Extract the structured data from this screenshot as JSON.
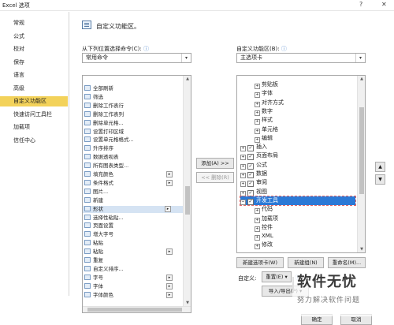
{
  "window": {
    "title": "Excel 选项",
    "help": "?",
    "close": "✕"
  },
  "nav": {
    "items": [
      {
        "label": "常规"
      },
      {
        "label": "公式"
      },
      {
        "label": "校对"
      },
      {
        "label": "保存"
      },
      {
        "label": "语言"
      },
      {
        "label": "高级"
      },
      {
        "label": "自定义功能区",
        "selected": true
      },
      {
        "label": "快速访问工具栏"
      },
      {
        "label": "加载项"
      },
      {
        "label": "信任中心"
      }
    ],
    "selected_color": "#f3d25a"
  },
  "header": {
    "title": "自定义功能区。"
  },
  "left": {
    "label": "从下列位置选择命令(C):",
    "info_icon": "ⓘ",
    "dropdown_value": "常用命令",
    "commands": [
      {
        "label": "全部刷新"
      },
      {
        "label": "筛选"
      },
      {
        "label": "删除工作表行"
      },
      {
        "label": "删除工作表列"
      },
      {
        "label": "删除单元格..."
      },
      {
        "label": "设置打印区域"
      },
      {
        "label": "设置单元格格式..."
      },
      {
        "label": "升序排序"
      },
      {
        "label": "数据透视表"
      },
      {
        "label": "所有图表类型..."
      },
      {
        "label": "填充颜色",
        "sub": true
      },
      {
        "label": "条件格式",
        "sub": true
      },
      {
        "label": "图片..."
      },
      {
        "label": "新建"
      },
      {
        "label": "形状",
        "sub": true,
        "highlight": true
      },
      {
        "label": "选择性粘贴..."
      },
      {
        "label": "页面设置"
      },
      {
        "label": "增大字号"
      },
      {
        "label": "粘贴"
      },
      {
        "label": "粘贴",
        "sub": true
      },
      {
        "label": "重复"
      },
      {
        "label": "自定义排序..."
      },
      {
        "label": "字号",
        "sub": true
      },
      {
        "label": "字体",
        "sub": true
      },
      {
        "label": "字体颜色",
        "sub": true
      }
    ]
  },
  "middle": {
    "add_label": "添加(A) >>",
    "remove_label": "<< 删除(R)"
  },
  "right": {
    "label": "自定义功能区(B):",
    "info_icon": "ⓘ",
    "dropdown_value": "主选项卡",
    "tree": [
      {
        "label": "剪贴板",
        "exp": "+",
        "cb": false,
        "level": 2
      },
      {
        "label": "字体",
        "exp": "+",
        "cb": false,
        "level": 2
      },
      {
        "label": "对齐方式",
        "exp": "+",
        "cb": false,
        "level": 2
      },
      {
        "label": "数字",
        "exp": "+",
        "cb": false,
        "level": 2
      },
      {
        "label": "样式",
        "exp": "+",
        "cb": false,
        "level": 2
      },
      {
        "label": "单元格",
        "exp": "+",
        "cb": false,
        "level": 2
      },
      {
        "label": "编辑",
        "exp": "+",
        "cb": false,
        "level": 2
      },
      {
        "label": "插入",
        "exp": "+",
        "cb": true,
        "level": 1
      },
      {
        "label": "页面布局",
        "exp": "+",
        "cb": true,
        "level": 1
      },
      {
        "label": "公式",
        "exp": "+",
        "cb": true,
        "level": 1
      },
      {
        "label": "数据",
        "exp": "+",
        "cb": true,
        "level": 1
      },
      {
        "label": "审阅",
        "exp": "+",
        "cb": true,
        "level": 1
      },
      {
        "label": "视图",
        "exp": "+",
        "cb": true,
        "level": 1
      },
      {
        "label": "开发工具",
        "exp": "−",
        "cb": true,
        "level": 1,
        "selected": true
      },
      {
        "label": "代码",
        "exp": "+",
        "cb": false,
        "level": 2
      },
      {
        "label": "加载项",
        "exp": "+",
        "cb": false,
        "level": 2
      },
      {
        "label": "控件",
        "exp": "+",
        "cb": false,
        "level": 2
      },
      {
        "label": "XML",
        "exp": "+",
        "cb": false,
        "level": 2
      },
      {
        "label": "修改",
        "exp": "+",
        "cb": false,
        "level": 2
      }
    ],
    "selected_color": "#2b79d6"
  },
  "buttons": {
    "new_tab": "新建选项卡(W)",
    "new_group": "新建组(N)",
    "rename": "重命名(M)...",
    "customize_label": "自定义:",
    "reset": "重置(E) ▾",
    "import_export": "导入/导出(P) ▾",
    "ok": "确定",
    "cancel": "取消"
  },
  "watermark": {
    "title": "软件无忧",
    "subtitle": "努力解决软件问题"
  }
}
